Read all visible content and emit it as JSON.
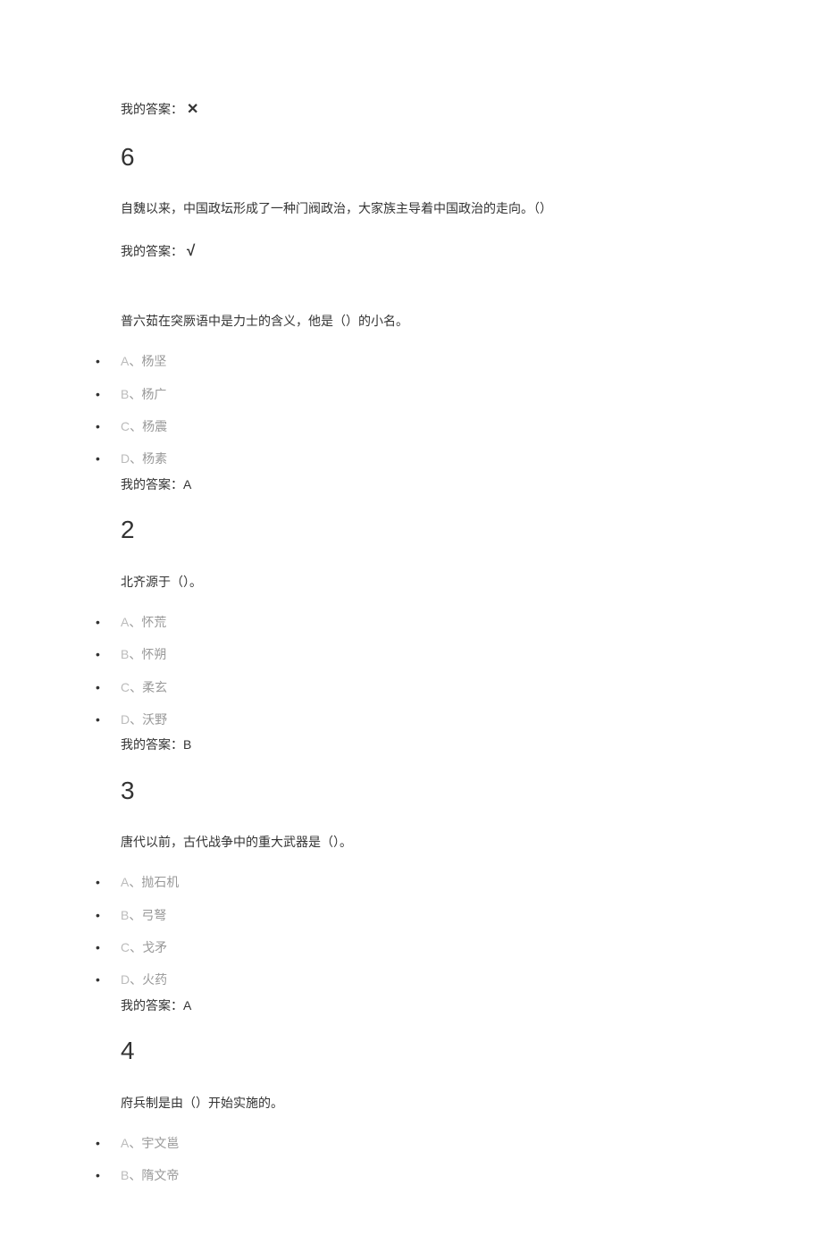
{
  "answer_label": "我的答案：",
  "q5": {
    "mark": "✕"
  },
  "q6": {
    "number": "6",
    "text": "自魏以来，中国政坛形成了一种门阀政治，大家族主导着中国政治的走向。（）",
    "mark": "√"
  },
  "q1b": {
    "text": "普六茹在突厥语中是力士的含义，他是（）的小名。",
    "options": [
      {
        "letter": "A",
        "text": "杨坚"
      },
      {
        "letter": "B",
        "text": "杨广"
      },
      {
        "letter": "C",
        "text": "杨震"
      },
      {
        "letter": "D",
        "text": "杨素"
      }
    ],
    "answer": "A"
  },
  "q2b": {
    "number": "2",
    "text": "北齐源于（）。",
    "options": [
      {
        "letter": "A",
        "text": "怀荒"
      },
      {
        "letter": "B",
        "text": "怀朔"
      },
      {
        "letter": "C",
        "text": "柔玄"
      },
      {
        "letter": "D",
        "text": "沃野"
      }
    ],
    "answer": "B"
  },
  "q3b": {
    "number": "3",
    "text": "唐代以前，古代战争中的重大武器是（）。",
    "options": [
      {
        "letter": "A",
        "text": "抛石机"
      },
      {
        "letter": "B",
        "text": "弓弩"
      },
      {
        "letter": "C",
        "text": "戈矛"
      },
      {
        "letter": "D",
        "text": "火药"
      }
    ],
    "answer": "A"
  },
  "q4b": {
    "number": "4",
    "text": "府兵制是由（）开始实施的。",
    "options": [
      {
        "letter": "A",
        "text": "宇文邕"
      },
      {
        "letter": "B",
        "text": "隋文帝"
      }
    ]
  },
  "sep": "、"
}
